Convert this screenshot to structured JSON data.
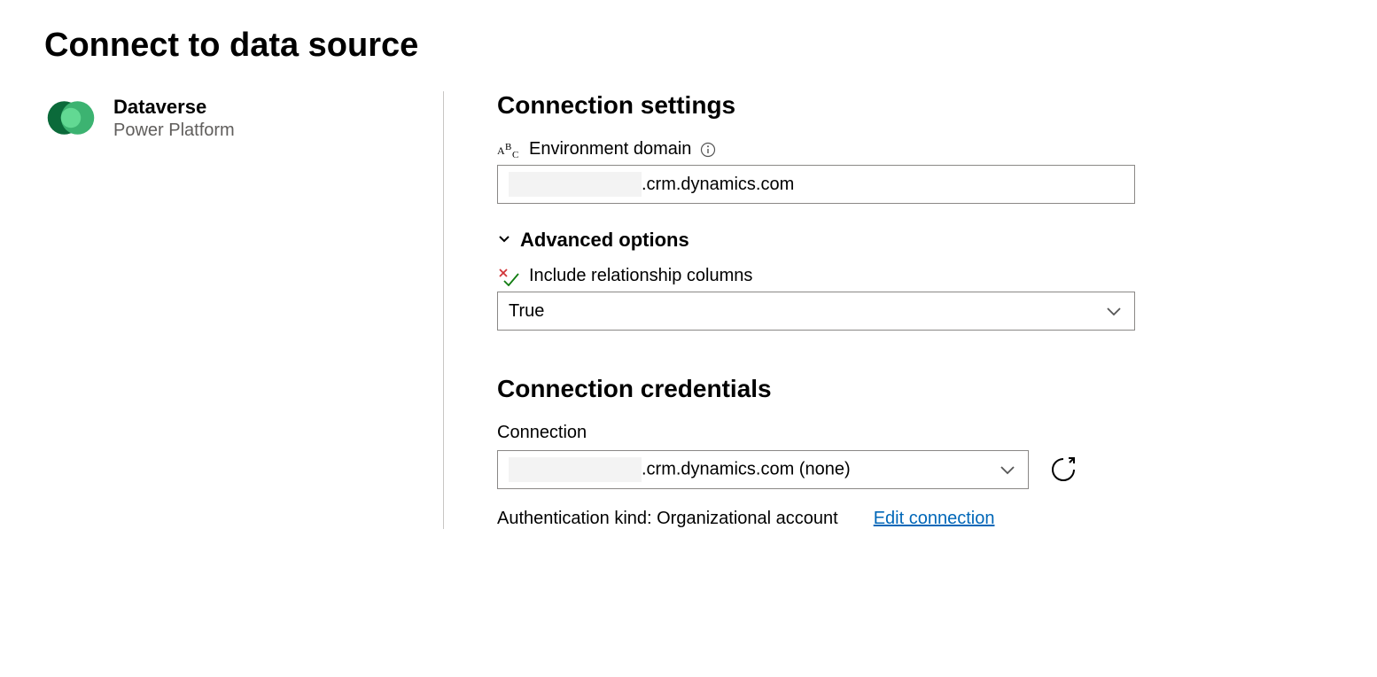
{
  "page": {
    "title": "Connect to data source"
  },
  "connector": {
    "name": "Dataverse",
    "category": "Power Platform"
  },
  "settings": {
    "header": "Connection settings",
    "environment_domain_label": "Environment domain",
    "environment_domain_value_suffix": ".crm.dynamics.com",
    "advanced_label": "Advanced options",
    "include_relationship_label": "Include relationship columns",
    "include_relationship_value": "True"
  },
  "credentials": {
    "header": "Connection credentials",
    "connection_label": "Connection",
    "connection_value_suffix": ".crm.dynamics.com (none)",
    "auth_kind_label": "Authentication kind: Organizational account",
    "edit_link": "Edit connection"
  }
}
